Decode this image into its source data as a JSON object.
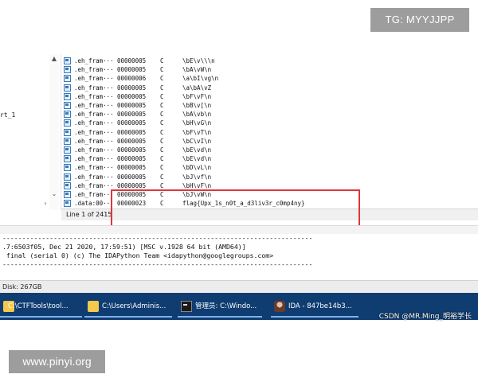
{
  "left_pane": {
    "fragment_text": "rt_1"
  },
  "strings_window": {
    "rows": [
      {
        "addr": ".eh_fram···",
        "len": "00000005",
        "type": "C",
        "str": "\\bE\\v\\\\\\n"
      },
      {
        "addr": ".eh_fram···",
        "len": "00000005",
        "type": "C",
        "str": "\\bA\\vW\\n"
      },
      {
        "addr": ".eh_fram···",
        "len": "00000006",
        "type": "C",
        "str": "\\a\\bI\\vg\\n"
      },
      {
        "addr": ".eh_fram···",
        "len": "00000005",
        "type": "C",
        "str": "\\a\\bA\\vZ"
      },
      {
        "addr": ".eh_fram···",
        "len": "00000005",
        "type": "C",
        "str": "\\bF\\vF\\n"
      },
      {
        "addr": ".eh_fram···",
        "len": "00000005",
        "type": "C",
        "str": "\\bB\\v[\\n"
      },
      {
        "addr": ".eh_fram···",
        "len": "00000005",
        "type": "C",
        "str": "\\bA\\vb\\n"
      },
      {
        "addr": ".eh_fram···",
        "len": "00000005",
        "type": "C",
        "str": "\\bH\\vG\\n"
      },
      {
        "addr": ".eh_fram···",
        "len": "00000005",
        "type": "C",
        "str": "\\bF\\vT\\n"
      },
      {
        "addr": ".eh_fram···",
        "len": "00000005",
        "type": "C",
        "str": "\\bC\\vI\\n"
      },
      {
        "addr": ".eh_fram···",
        "len": "00000005",
        "type": "C",
        "str": "\\bE\\vd\\n"
      },
      {
        "addr": ".eh_fram···",
        "len": "00000005",
        "type": "C",
        "str": "\\bE\\vd\\n"
      },
      {
        "addr": ".eh_fram···",
        "len": "00000005",
        "type": "C",
        "str": "\\bD\\vL\\n"
      },
      {
        "addr": ".eh_fram···",
        "len": "00000005",
        "type": "C",
        "str": "\\bJ\\vf\\n"
      },
      {
        "addr": ".eh_fram···",
        "len": "00000005",
        "type": "C",
        "str": "\\bH\\vF\\n"
      },
      {
        "addr": ".eh_fram···",
        "len": "00000005",
        "type": "C",
        "str": "\\bJ\\vW\\n"
      },
      {
        "addr": ".data:00···",
        "len": "00000023",
        "type": "C",
        "str": "flag{Upx_1s_n0t_a_d3liv3r_c0mp4ny}"
      }
    ],
    "status_line": "Line 1 of 2415"
  },
  "console": {
    "line1": ".7:6503f05, Dec 21 2020, 17:59:51) [MSC v.1928 64 bit (AMD64)]",
    "line2": " final (serial 0) (c) The IDAPython Team <idapython@googlegroups.com>",
    "dash": "-------------------------------------------------------------------------------"
  },
  "disk_status": "Disk: 267GB",
  "taskbar": {
    "items": [
      {
        "label": "C:\\CTFTools\\tool...",
        "icon": "folder-icon"
      },
      {
        "label": "C:\\Users\\Adminis...",
        "icon": "folder-icon"
      },
      {
        "label": "管理员: C:\\Windo...",
        "icon": "terminal-icon"
      },
      {
        "label": "IDA - 847be14b3...",
        "icon": "ida-icon"
      }
    ]
  },
  "watermarks": {
    "tg": "TG: MYYJJPP",
    "csdn": "CSDN @MR.Ming_明裕学长",
    "pinyi": "www.pinyi.org"
  },
  "colors": {
    "highlight": "#e0363b",
    "taskbar": "#0f3d72"
  }
}
